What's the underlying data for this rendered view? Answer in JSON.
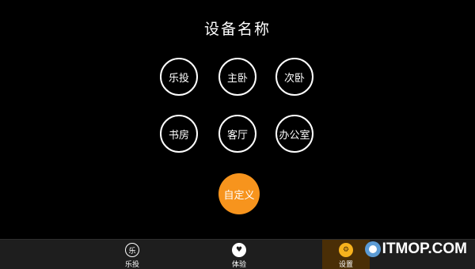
{
  "page": {
    "title": "设备名称"
  },
  "name_options": [
    {
      "label": "乐投"
    },
    {
      "label": "主卧"
    },
    {
      "label": "次卧"
    },
    {
      "label": "书房"
    },
    {
      "label": "客厅"
    },
    {
      "label": "办公室"
    }
  ],
  "custom_button": {
    "label": "自定义",
    "color": "#f7941d"
  },
  "bottom_nav": {
    "items": [
      {
        "label": "乐投",
        "icon": "letou-logo-icon",
        "glyph": "乐"
      },
      {
        "label": "体验",
        "icon": "heart-icon",
        "glyph": "♥"
      },
      {
        "label": "设置",
        "icon": "gear-icon",
        "glyph": "⚙",
        "active": true
      }
    ]
  },
  "watermark": {
    "text": "ITMOP.COM"
  }
}
